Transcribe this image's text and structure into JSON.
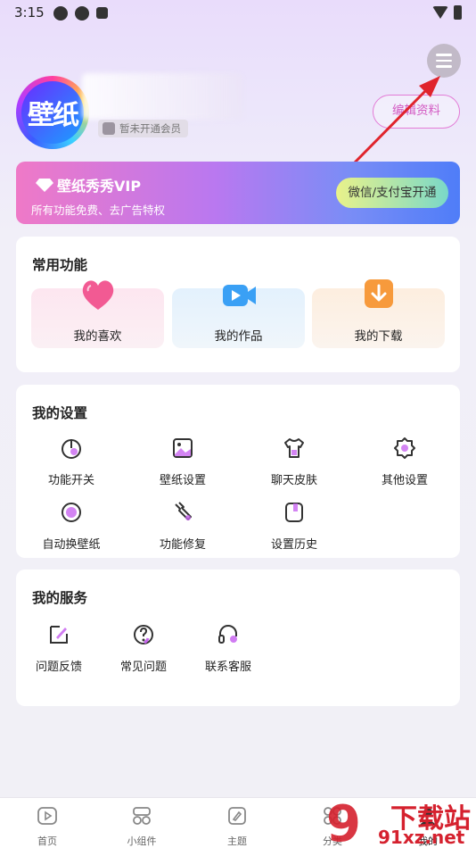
{
  "status_bar": {
    "time": "3:15"
  },
  "profile": {
    "avatar_text": "壁纸",
    "vip_status": "暂未开通会员",
    "edit_label": "编辑资料"
  },
  "vip_banner": {
    "title": "壁纸秀秀VIP",
    "subtitle": "所有功能免费、去广告特权",
    "button_label": "微信/支付宝开通"
  },
  "common_functions": {
    "title": "常用功能",
    "items": [
      {
        "label": "我的喜欢",
        "icon": "heart-icon"
      },
      {
        "label": "我的作品",
        "icon": "video-camera-icon"
      },
      {
        "label": "我的下载",
        "icon": "download-icon"
      }
    ]
  },
  "settings": {
    "title": "我的设置",
    "items": [
      {
        "label": "功能开关",
        "icon": "power-icon"
      },
      {
        "label": "壁纸设置",
        "icon": "image-icon"
      },
      {
        "label": "聊天皮肤",
        "icon": "shirt-icon"
      },
      {
        "label": "其他设置",
        "icon": "gear-icon"
      },
      {
        "label": "自动换壁纸",
        "icon": "auto-switch-icon"
      },
      {
        "label": "功能修复",
        "icon": "wrench-icon"
      },
      {
        "label": "设置历史",
        "icon": "history-icon"
      }
    ]
  },
  "services": {
    "title": "我的服务",
    "items": [
      {
        "label": "问题反馈",
        "icon": "feedback-icon"
      },
      {
        "label": "常见问题",
        "icon": "question-icon"
      },
      {
        "label": "联系客服",
        "icon": "headset-icon"
      }
    ]
  },
  "bottom_nav": {
    "items": [
      {
        "label": "首页",
        "icon": "play-icon"
      },
      {
        "label": "小组件",
        "icon": "widget-icon"
      },
      {
        "label": "主题",
        "icon": "theme-icon"
      },
      {
        "label": "分类",
        "icon": "category-icon"
      },
      {
        "label": "我的",
        "icon": "profile-icon"
      }
    ]
  },
  "watermark": {
    "text": "下载站",
    "domain": "91xz.net"
  },
  "colors": {
    "accent_pink": "#d35bc3",
    "vip_gradient_start": "#ef79c7",
    "vip_gradient_end": "#4f7df8",
    "annotation_arrow": "#e0242c"
  }
}
